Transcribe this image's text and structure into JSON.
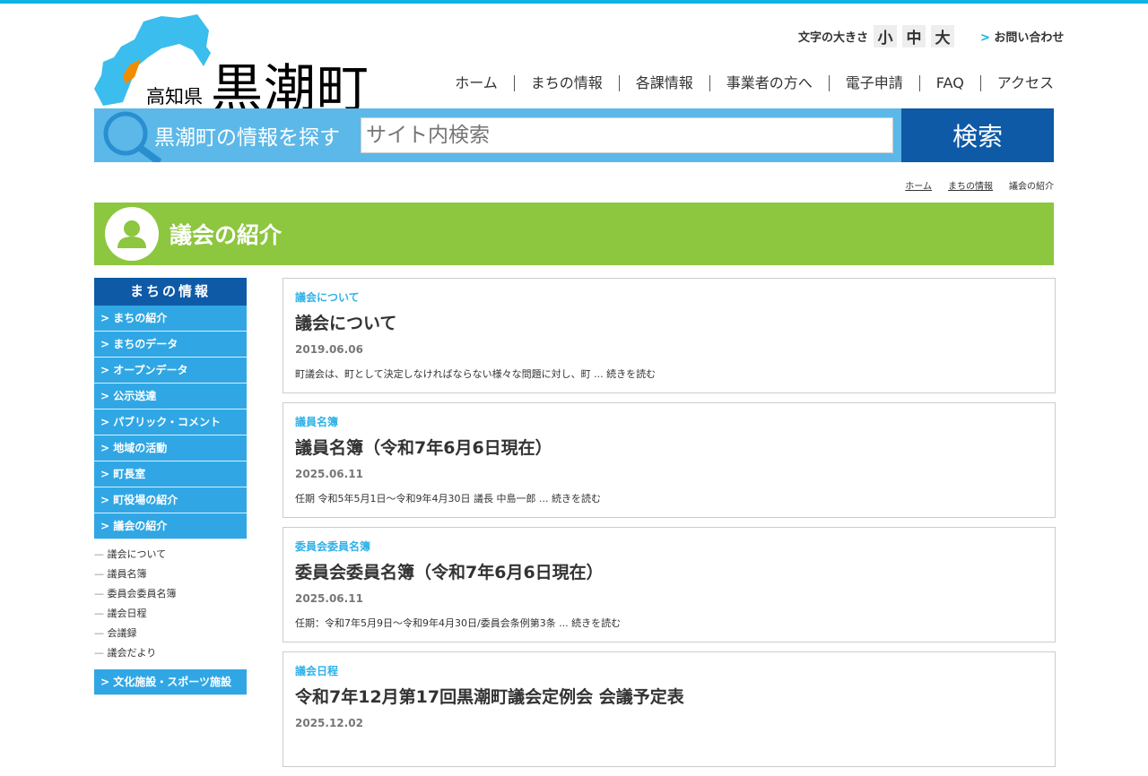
{
  "header": {
    "prefecture": "高知県",
    "town": "黒潮町",
    "font_size_label": "文字の大きさ",
    "font_sizes": [
      "小",
      "中",
      "大"
    ],
    "contact": "お問い合わせ"
  },
  "nav": [
    "ホーム",
    "まちの情報",
    "各課情報",
    "事業者の方へ",
    "電子申請",
    "FAQ",
    "アクセス"
  ],
  "search": {
    "label": "黒潮町の情報を探す",
    "placeholder": "サイト内検索",
    "button": "検索"
  },
  "breadcrumb": [
    "ホーム",
    "まちの情報",
    "議会の紹介"
  ],
  "page_title": "議会の紹介",
  "sidebar": {
    "heading": "まちの情報",
    "items": [
      "> まちの紹介",
      "> まちのデータ",
      "> オープンデータ",
      "> 公示送達",
      "> パブリック・コメント",
      "> 地域の活動",
      "> 町長室",
      "> 町役場の紹介",
      "> 議会の紹介"
    ],
    "subitems": [
      "議会について",
      "議員名簿",
      "委員会委員名簿",
      "議会日程",
      "会議録",
      "議会だより"
    ],
    "after": [
      "> 文化施設・スポーツ施設"
    ]
  },
  "posts": [
    {
      "category": "議会について",
      "title": "議会について",
      "date": "2019.06.06",
      "excerpt": "町議会は、町として決定しなければならない様々な問題に対し、町 ... 続きを読む"
    },
    {
      "category": "議員名簿",
      "title": "議員名簿（令和7年6月6日現在）",
      "date": "2025.06.11",
      "excerpt": "任期 令和5年5月1日～令和9年4月30日 議長 中島一郎 ... 続きを読む"
    },
    {
      "category": "委員会委員名簿",
      "title": "委員会委員名簿（令和7年6月6日現在）",
      "date": "2025.06.11",
      "excerpt": "任期：令和7年5月9日～令和9年4月30日/委員会条例第3条 ... 続きを読む"
    },
    {
      "category": "議会日程",
      "title": "令和7年12月第17回黒潮町議会定例会 会議予定表",
      "date": "2025.12.02",
      "excerpt": ""
    }
  ]
}
